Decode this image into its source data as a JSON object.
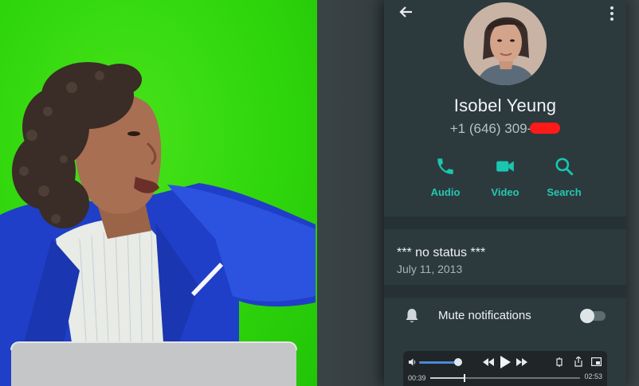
{
  "contact": {
    "name": "Isobel Yeung",
    "phone_prefix": "+1 (646) 309-",
    "status": "*** no status ***",
    "status_date": "July 11, 2013"
  },
  "actions": [
    {
      "label": "Audio",
      "icon": "phone-icon"
    },
    {
      "label": "Video",
      "icon": "video-camera-icon"
    },
    {
      "label": "Search",
      "icon": "search-icon"
    }
  ],
  "settings": {
    "mute_label": "Mute notifications",
    "mute_enabled": false
  },
  "player": {
    "current_time": "00:39",
    "total_time": "02:53",
    "progress": 0.225,
    "volume": 0.85
  },
  "colors": {
    "accent": "#19c6b0",
    "screen_bg": "#2c3a3e",
    "redaction": "#ff1a1a",
    "green_screen": "#2fd60c"
  }
}
